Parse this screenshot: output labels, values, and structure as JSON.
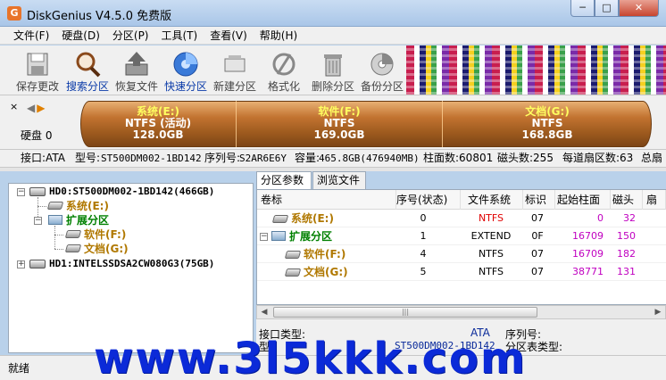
{
  "window": {
    "title": "DiskGenius V4.5.0 免费版",
    "icon_letter": "G",
    "min_label": "─",
    "max_label": "□",
    "close_label": "✕"
  },
  "menu": [
    "文件(F)",
    "硬盘(D)",
    "分区(P)",
    "工具(T)",
    "查看(V)",
    "帮助(H)"
  ],
  "toolbar": {
    "buttons": [
      {
        "label": "保存更改",
        "icon": "save-icon"
      },
      {
        "label": "搜索分区",
        "icon": "magnifier-icon"
      },
      {
        "label": "恢复文件",
        "icon": "recover-file-icon"
      },
      {
        "label": "快速分区",
        "icon": "quick-partition-icon"
      },
      {
        "label": "新建分区",
        "icon": "new-partition-icon"
      },
      {
        "label": "格式化",
        "icon": "format-icon"
      },
      {
        "label": "删除分区",
        "icon": "trash-icon"
      },
      {
        "label": "备份分区",
        "icon": "backup-icon"
      }
    ]
  },
  "diskbar": {
    "close": "×",
    "arrows_left": "◀",
    "arrows_right": "▶",
    "disk_label": "硬盘 0",
    "segments": [
      {
        "name": "系统(E:)",
        "fs": "NTFS (活动)",
        "size": "128.0GB"
      },
      {
        "name": "软件(F:)",
        "fs": "NTFS",
        "size": "169.0GB"
      },
      {
        "name": "文档(G:)",
        "fs": "NTFS",
        "size": "168.8GB"
      }
    ]
  },
  "info": {
    "iface": "接口:ATA",
    "model_label": "型号:",
    "model": "ST500DM002-1BD142",
    "serial_label": "序列号:",
    "serial": "S2AR6E6Y",
    "capacity_label": "容量:",
    "capacity": "465.8GB(476940MB)",
    "cyl": "柱面数:60801",
    "heads": "磁头数:255",
    "sectors": "每道扇区数:63",
    "total": "总扇"
  },
  "tree": {
    "hd0": "HD0:ST500DM002-1BD142(466GB)",
    "sys": "系统(E:)",
    "ext": "扩展分区",
    "soft": "软件(F:)",
    "doc": "文档(G:)",
    "hd1": "HD1:INTELSSDSA2CW080G3(75GB)",
    "minus": "−",
    "plus": "+"
  },
  "tabs": [
    "分区参数",
    "浏览文件"
  ],
  "table": {
    "headers": [
      "卷标",
      "序号(状态)",
      "文件系统",
      "标识",
      "起始柱面",
      "磁头",
      "扇"
    ],
    "rows": [
      {
        "label": "系统(E:)",
        "seq": "0",
        "fs": "NTFS",
        "id": "07",
        "cyl": "0",
        "head": "32"
      },
      {
        "label": "扩展分区",
        "seq": "1",
        "fs": "EXTEND",
        "id": "0F",
        "cyl": "16709",
        "head": "150"
      },
      {
        "label": "软件(F:)",
        "seq": "4",
        "fs": "NTFS",
        "id": "07",
        "cyl": "16709",
        "head": "182"
      },
      {
        "label": "文档(G:)",
        "seq": "5",
        "fs": "NTFS",
        "id": "07",
        "cyl": "38771",
        "head": "131"
      }
    ]
  },
  "scroll": {
    "left": "◀",
    "right": "▶",
    "grip": "|||"
  },
  "detail": {
    "iface_label": "接口类型:",
    "iface_value": "ATA",
    "serial_label": "序列号:",
    "model_label": "型",
    "model_value": "ST500DM002-1BD142",
    "ptable_label": "分区表类型:"
  },
  "status": "就绪",
  "watermark": "www.3l5kkk.com"
}
